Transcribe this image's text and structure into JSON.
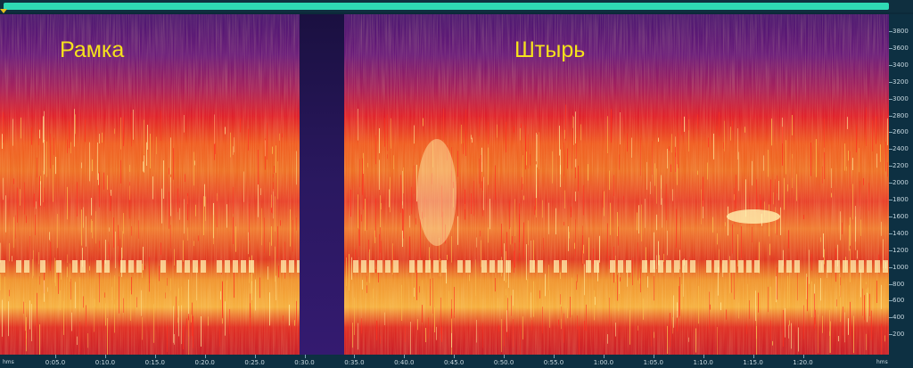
{
  "overlay_labels": {
    "left": "Рамка",
    "right": "Штырь"
  },
  "freq_axis": {
    "ticks": [
      "3800",
      "3600",
      "3400",
      "3200",
      "3000",
      "2800",
      "2600",
      "2400",
      "2200",
      "2000",
      "1800",
      "1600",
      "1400",
      "1200",
      "1000",
      "800",
      "600",
      "400",
      "200"
    ]
  },
  "time_axis": {
    "unit_left": "hms",
    "unit_right": "hms",
    "ticks": [
      "0:05.0",
      "0:10.0",
      "0:15.0",
      "0:20.0",
      "0:25.0",
      "0:30.0",
      "0:35.0",
      "0:40.0",
      "0:45.0",
      "0:50.0",
      "0:55.0",
      "1:00.0",
      "1:05.0",
      "1:10.0",
      "1:15.0",
      "1:20.0"
    ]
  },
  "colors": {
    "scrollbar": "#2fd9b4",
    "playhead": "#e6c020",
    "label": "#f5e21c"
  }
}
